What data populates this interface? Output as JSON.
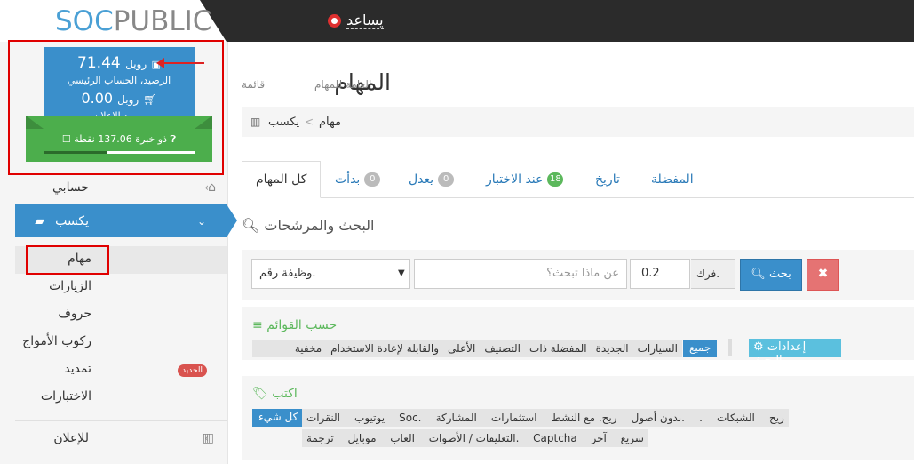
{
  "logo": {
    "soc": "SOC",
    "pub": "PUBLIC"
  },
  "header": {
    "help_label": "يساعد"
  },
  "balance": {
    "main_amount": "71.44",
    "main_currency": "روبل",
    "main_label": "الرصيد، الحساب الرئيسي",
    "ad_amount": "0.00",
    "ad_currency": "روبل",
    "ad_label": "رصيد الإعلان",
    "experience_text": "ذو خبرة 137.06 نقطة",
    "experience_progress": 0.42
  },
  "sidebar": {
    "account": "حسابي",
    "earn": "يكسب",
    "advertise": "للإعلان",
    "subitems": [
      "مهام",
      "الزيارات",
      "حروف",
      "ركوب الأمواج",
      "تمديد",
      "الاختبارات"
    ],
    "new_badge": "الجديد"
  },
  "page": {
    "title": "المهام",
    "pre": "قائمة",
    "subtitle": "العامة للمهام"
  },
  "breadcrumb": {
    "earn": "يكسب",
    "sep": "<",
    "tasks": "مهام"
  },
  "tabs": [
    {
      "label": "كل المهام"
    },
    {
      "label": "بدأت",
      "count": "0"
    },
    {
      "label": "يعدل",
      "count": "0"
    },
    {
      "label": "عند الاختبار",
      "count": "18"
    },
    {
      "label": "تاريخ"
    },
    {
      "label": "المفضلة"
    }
  ],
  "filters": {
    "title": "البحث والمرشحات",
    "select_value": "وظيفة رقم.",
    "search_placeholder": "عن ماذا تبحث؟",
    "number_value": "0.2",
    "difficulty_label": "فرك.",
    "search_button": "بحث"
  },
  "lists": {
    "title": "حسب القوائم",
    "settings_button": "إعدادات البحث",
    "active": "جميع",
    "items": [
      "السيارات",
      "الجديدة",
      "المفضلة ذات",
      "التصنيف",
      "الأعلى",
      "والقابلة لإعادة الاستخدام",
      "مخفية"
    ]
  },
  "write": {
    "title": "اكتب",
    "active": "كل شيء",
    "row1": [
      "النقرات",
      "يوتيوب",
      "Soc.",
      "المشاركة",
      "استثمارات",
      "ريح. مع النشط",
      "بدون أصول.",
      ".",
      "الشبكات",
      "ريح"
    ],
    "row2": [
      "ترجمة",
      "موبايل",
      "العاب",
      "التعليقات / الأصوات.",
      "Captcha",
      "آخر",
      "سريع"
    ]
  },
  "colors": {
    "brand_blue": "#3a8fcb",
    "green": "#4cae4c",
    "highlight_red": "#e00000"
  }
}
